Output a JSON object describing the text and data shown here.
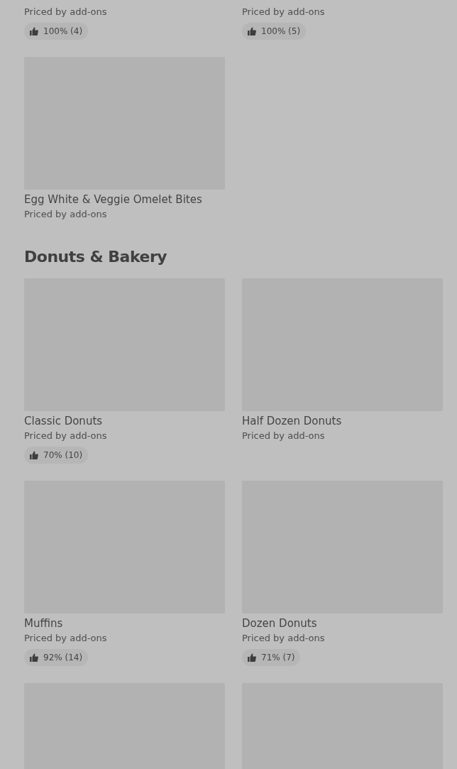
{
  "sections": [
    {
      "items": [
        {
          "image": false,
          "subtitle": "Priced by add-ons",
          "rating": "100% (4)"
        },
        {
          "image": false,
          "subtitle": "Priced by add-ons",
          "rating": "100% (5)"
        },
        {
          "image": true,
          "title": "Egg White & Veggie Omelet Bites",
          "subtitle": "Priced by add-ons"
        }
      ]
    },
    {
      "title": "Donuts & Bakery",
      "items": [
        {
          "image": true,
          "title": "Classic Donuts",
          "subtitle": "Priced by add-ons",
          "rating": "70% (10)"
        },
        {
          "image": true,
          "title": "Half Dozen Donuts",
          "subtitle": "Priced by add-ons"
        },
        {
          "image": true,
          "title": "Muffins",
          "subtitle": "Priced by add-ons",
          "rating": "92% (14)"
        },
        {
          "image": true,
          "title": "Dozen Donuts",
          "subtitle": "Priced by add-ons",
          "rating": "71% (7)"
        },
        {
          "image": true
        },
        {
          "image": true
        }
      ]
    }
  ]
}
